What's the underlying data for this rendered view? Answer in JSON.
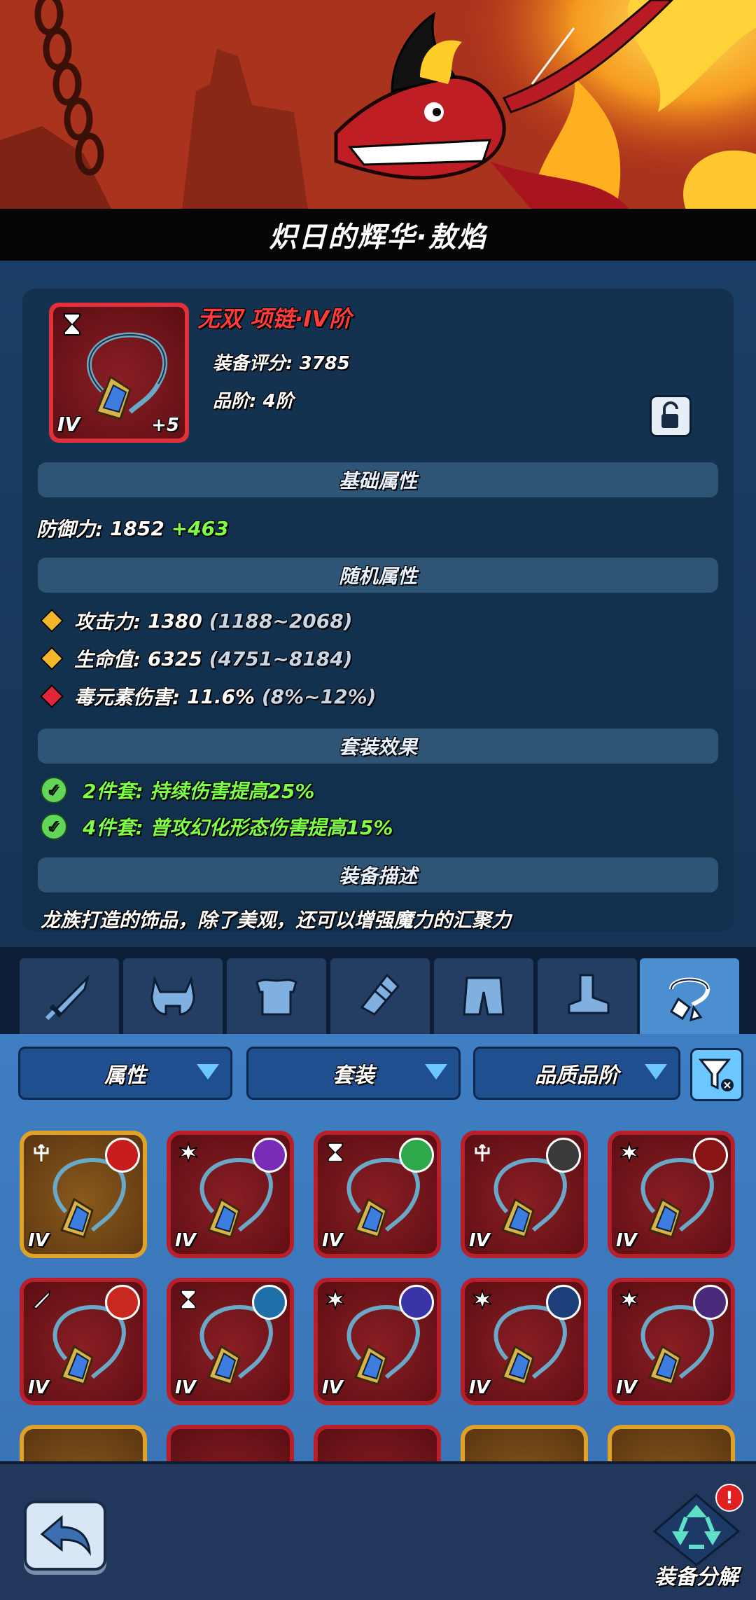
{
  "banner": {
    "title": "炽日的辉华·敖焰"
  },
  "equipment": {
    "name": "无双 项链·IV阶",
    "score_label": "装备评分:",
    "score": "3785",
    "grade_label": "品阶:",
    "grade": "4阶",
    "tier": "IV",
    "enhance": "+5"
  },
  "sections": {
    "base": "基础属性",
    "random": "随机属性",
    "set": "套装效果",
    "description": "装备描述"
  },
  "base_stat": {
    "label": "防御力:",
    "value": "1852",
    "bonus": "+463"
  },
  "random_stats": [
    {
      "label": "攻击力:",
      "value": "1380",
      "range": "(1188~2068)",
      "color": "#f5b72a"
    },
    {
      "label": "生命值:",
      "value": "6325",
      "range": "(4751~8184)",
      "color": "#f5b72a"
    },
    {
      "label": "毒元素伤害:",
      "value": "11.6%",
      "range": "(8%~12%)",
      "color": "#e2263a"
    }
  ],
  "set_effects": [
    {
      "text": "2件套: 持续伤害提高25%"
    },
    {
      "text": "4件套: 普攻幻化形态伤害提高15%"
    }
  ],
  "description_text": "龙族打造的饰品，除了美观，还可以增强魔力的汇聚力",
  "tabs": [
    {
      "icon": "sword-icon"
    },
    {
      "icon": "helmet-icon"
    },
    {
      "icon": "armor-icon"
    },
    {
      "icon": "gauntlet-icon"
    },
    {
      "icon": "pants-icon"
    },
    {
      "icon": "boots-icon"
    },
    {
      "icon": "necklace-icon",
      "active": true
    }
  ],
  "filters": {
    "attribute": "属性",
    "set": "套装",
    "quality": "品质品阶"
  },
  "items": [
    {
      "tier": "IV",
      "type_icon": "trident-icon",
      "avatar_color": "#c81d1d",
      "frame": "gold"
    },
    {
      "tier": "IV",
      "type_icon": "burst-icon",
      "avatar_color": "#7a2bb8",
      "frame": "red"
    },
    {
      "tier": "IV",
      "type_icon": "hourglass-icon",
      "avatar_color": "#2ea84a",
      "frame": "red"
    },
    {
      "tier": "IV",
      "type_icon": "trident-icon",
      "avatar_color": "#3a3a3a",
      "frame": "red"
    },
    {
      "tier": "IV",
      "type_icon": "burst-icon",
      "avatar_color": "#8a1414",
      "frame": "red"
    },
    {
      "tier": "IV",
      "type_icon": "sword-icon",
      "avatar_color": "#c8281e",
      "frame": "red"
    },
    {
      "tier": "IV",
      "type_icon": "hourglass-icon",
      "avatar_color": "#1f6fa8",
      "frame": "red"
    },
    {
      "tier": "IV",
      "type_icon": "burst-icon",
      "avatar_color": "#3b33a8",
      "frame": "red"
    },
    {
      "tier": "IV",
      "type_icon": "burst-icon",
      "avatar_color": "#1c3f7a",
      "frame": "red"
    },
    {
      "tier": "IV",
      "type_icon": "burst-icon",
      "avatar_color": "#4a2a7a",
      "frame": "red"
    }
  ],
  "bottom": {
    "salvage_label": "装备分解",
    "badge": "!"
  }
}
